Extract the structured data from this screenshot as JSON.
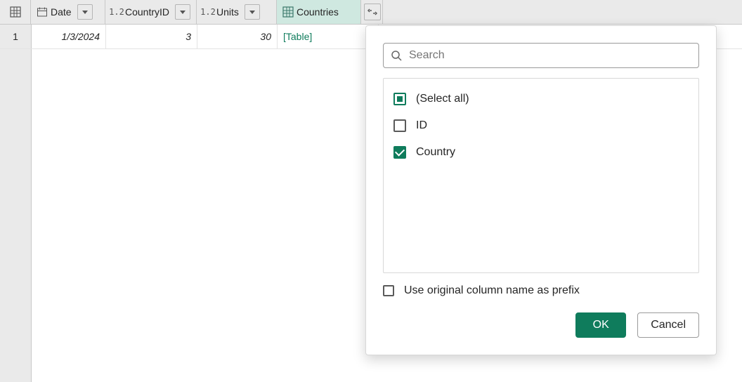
{
  "columns": {
    "date": {
      "label": "Date"
    },
    "cid": {
      "label": "CountryID",
      "type_glyph": "1.2"
    },
    "units": {
      "label": "Units",
      "type_glyph": "1.2"
    },
    "countries": {
      "label": "Countries"
    }
  },
  "rows": [
    {
      "num": "1",
      "date": "1/3/2024",
      "cid": "3",
      "units": "30",
      "countries": "[Table]"
    }
  ],
  "popup": {
    "search_placeholder": "Search",
    "options": {
      "select_all": "(Select all)",
      "id": "ID",
      "country": "Country"
    },
    "prefix_label": "Use original column name as prefix",
    "ok": "OK",
    "cancel": "Cancel"
  }
}
